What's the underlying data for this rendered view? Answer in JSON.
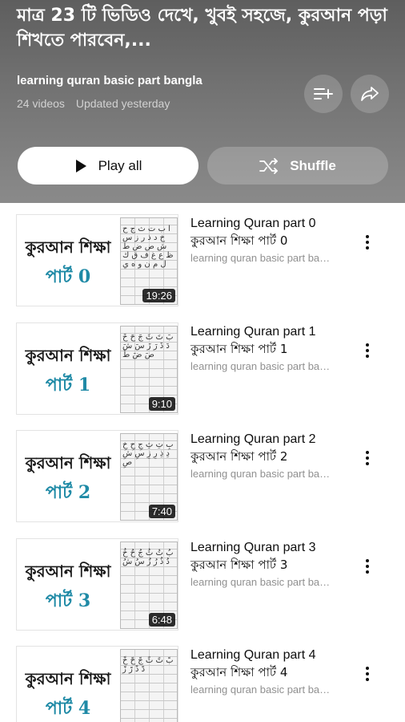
{
  "playlist": {
    "title": "মাত্র 23 টি ভিডিও দেখে, খুবই সহজে, কুরআন পড়া শিখতে পারবেন,...",
    "name": "learning quran basic part bangla",
    "video_count": "24 videos",
    "updated": "Updated yesterday"
  },
  "actions": {
    "play_all": "Play all",
    "shuffle": "Shuffle",
    "icons": [
      "add-to-queue-icon",
      "share-icon",
      "play-icon",
      "shuffle-icon",
      "more-vert-icon"
    ]
  },
  "videos": [
    {
      "title": "Learning Quran part 0",
      "title_bn": "কুরআন শিক্ষা পার্ট 0",
      "channel": "learning quran basic part bangla",
      "duration": "19:26",
      "thumb_title": "কুরআন শিক্ষা",
      "thumb_part": "পার্ট 0"
    },
    {
      "title": "Learning Quran part 1",
      "title_bn": "কুরআন শিক্ষা পার্ট 1",
      "channel": "learning quran basic part bangla",
      "duration": "9:10",
      "thumb_title": "কুরআন শিক্ষা",
      "thumb_part": "পার্ট 1"
    },
    {
      "title": "Learning Quran part 2",
      "title_bn": "কুরআন শিক্ষা পার্ট 2",
      "channel": "learning quran basic part bangla",
      "duration": "7:40",
      "thumb_title": "কুরআন শিক্ষা",
      "thumb_part": "পার্ট 2"
    },
    {
      "title": "Learning Quran part 3",
      "title_bn": "কুরআন শিক্ষা পার্ট 3",
      "channel": "learning quran basic part bangla",
      "duration": "6:48",
      "thumb_title": "কুরআন শিক্ষা",
      "thumb_part": "পার্ট 3"
    },
    {
      "title": "Learning Quran part 4",
      "title_bn": "কুরআন শিক্ষা পার্ট 4",
      "channel": "learning quran basic part bangla",
      "duration": "",
      "thumb_title": "কুরআন শিক্ষা",
      "thumb_part": "পার্ট 4"
    }
  ],
  "colors": {
    "accent_part": "#1f8aa6",
    "header_bg": "#6b6b6b"
  }
}
